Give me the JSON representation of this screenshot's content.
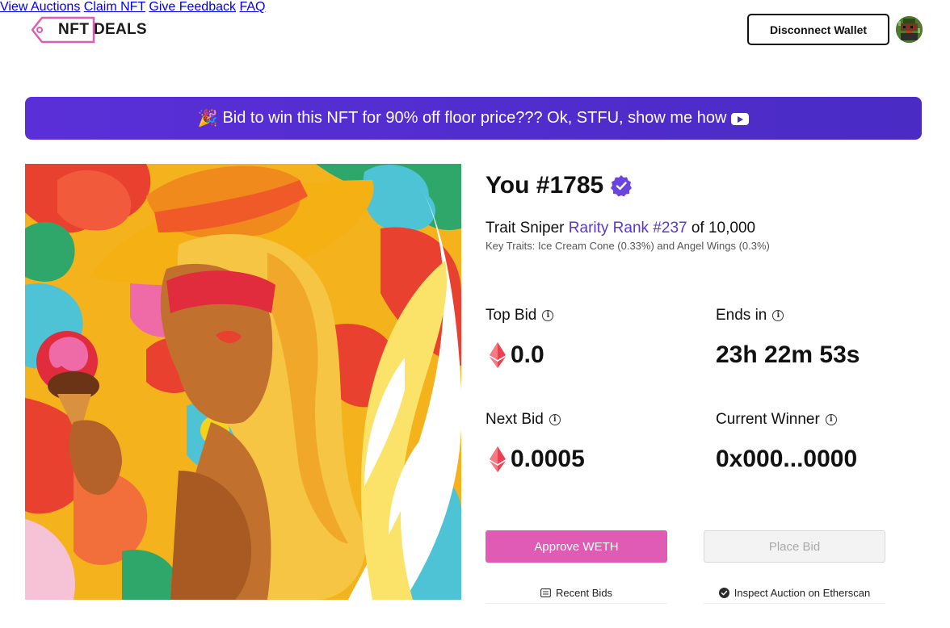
{
  "header": {
    "logo_nft": "NFT",
    "logo_deals": "DEALS",
    "nav": [
      {
        "label": "View Auctions"
      },
      {
        "label": "Claim NFT"
      },
      {
        "label": "Give Feedback"
      },
      {
        "label": "FAQ"
      }
    ],
    "disconnect_label": "Disconnect Wallet"
  },
  "banner": {
    "emoji": "🎉",
    "text": "Bid to win this NFT for 90% off floor price??? Ok, STFU, show me how"
  },
  "nft": {
    "title": "You #1785",
    "rarity_prefix": "Trait Sniper ",
    "rarity_rank": "Rarity Rank #237",
    "rarity_suffix": " of 10,000",
    "key_traits": "Key Traits: Ice Cream Cone (0.33%) and Angel Wings (0.3%)"
  },
  "auction": {
    "top_bid_label": "Top Bid",
    "top_bid_value": "0.0",
    "ends_in_label": "Ends in",
    "ends_in_value": "23h 22m 53s",
    "next_bid_label": "Next Bid",
    "next_bid_value": "0.0005",
    "winner_label": "Current Winner",
    "winner_value": "0x000...0000"
  },
  "actions": {
    "approve_label": "Approve WETH",
    "place_bid_label": "Place Bid",
    "recent_bids_label": "Recent Bids",
    "etherscan_label": "Inspect Auction on Etherscan"
  },
  "colors": {
    "brand_pink": "#e05cb4",
    "banner_purple": "#5a2fd8",
    "rank_purple": "#5b35d5",
    "eth_red": "#e8414f"
  },
  "icons": {
    "verified": "verified-badge-icon",
    "info": "info-icon",
    "eth": "ethereum-icon",
    "youtube": "youtube-icon",
    "list": "list-icon",
    "etherscan": "etherscan-icon"
  }
}
